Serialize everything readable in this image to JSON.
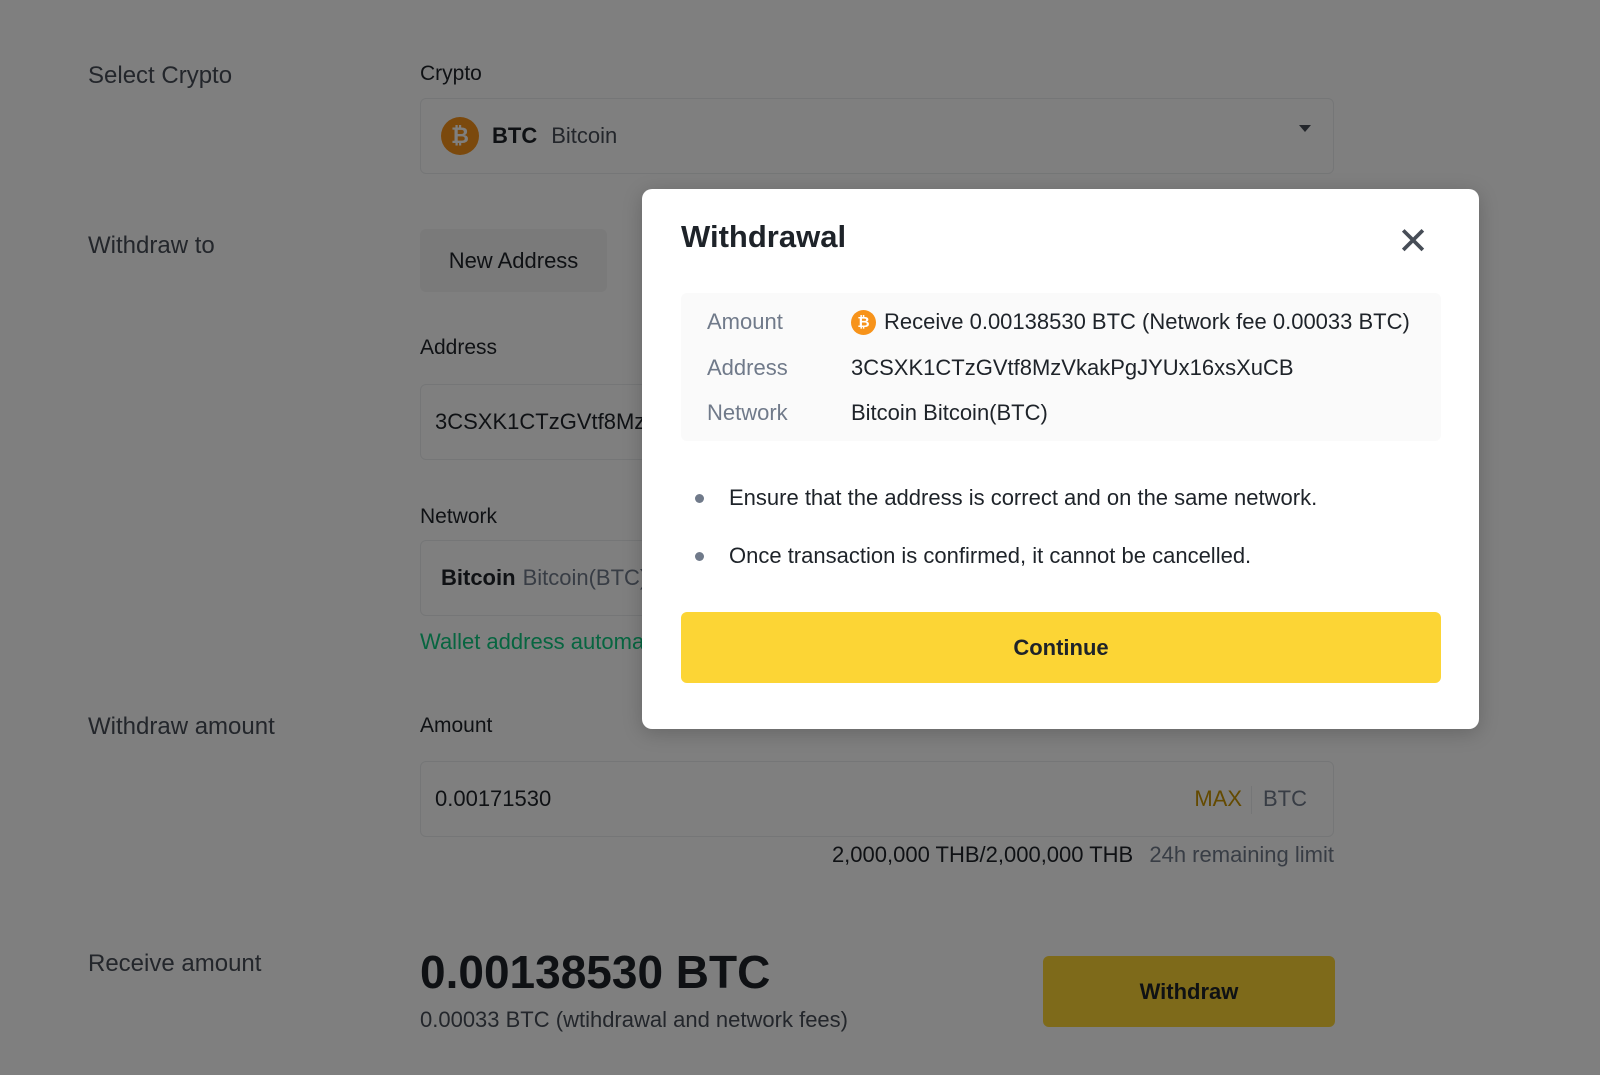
{
  "form": {
    "select_crypto_label": "Select Crypto",
    "crypto_field_label": "Crypto",
    "crypto_symbol": "BTC",
    "crypto_name": "Bitcoin",
    "crypto_icon_glyph": "₿",
    "withdraw_to_label": "Withdraw to",
    "new_address_tab": "New Address",
    "address_label": "Address",
    "address_value": "3CSXK1CTzGVtf8Mz",
    "network_label": "Network",
    "network_name": "Bitcoin",
    "network_detail": "Bitcoin(BTC)",
    "wallet_hint": "Wallet address automa",
    "withdraw_amount_label": "Withdraw amount",
    "amount_label": "Amount",
    "amount_value": "0.00171530",
    "max_label": "MAX",
    "unit_label": "BTC",
    "limit_value": "2,000,000 THB/2,000,000 THB",
    "limit_label": "24h remaining limit",
    "receive_amount_label": "Receive amount",
    "receive_value": "0.00138530 BTC",
    "fee_note": "0.00033 BTC (wtihdrawal and network fees)",
    "withdraw_button": "Withdraw"
  },
  "modal": {
    "title": "Withdrawal",
    "close_glyph": "✕",
    "amount_key": "Amount",
    "amount_value": "Receive 0.00138530 BTC (Network fee 0.00033 BTC)",
    "address_key": "Address",
    "address_value": "3CSXK1CTzGVtf8MzVkakPgJYUx16xsXuCB",
    "network_key": "Network",
    "network_value": "Bitcoin Bitcoin(BTC)",
    "notes": [
      "Ensure that the address is correct and on the same network.",
      "Once transaction is confirmed, it cannot be cancelled."
    ],
    "continue_button": "Continue"
  },
  "colors": {
    "accent_yellow": "#fcd535",
    "btc_orange": "#f7931a",
    "hint_green": "#0ecb81",
    "overlay": "rgba(0,0,0,0.5)"
  },
  "icons": {
    "crypto": "bitcoin-icon",
    "dropdown": "caret-down-icon",
    "close": "close-icon"
  }
}
